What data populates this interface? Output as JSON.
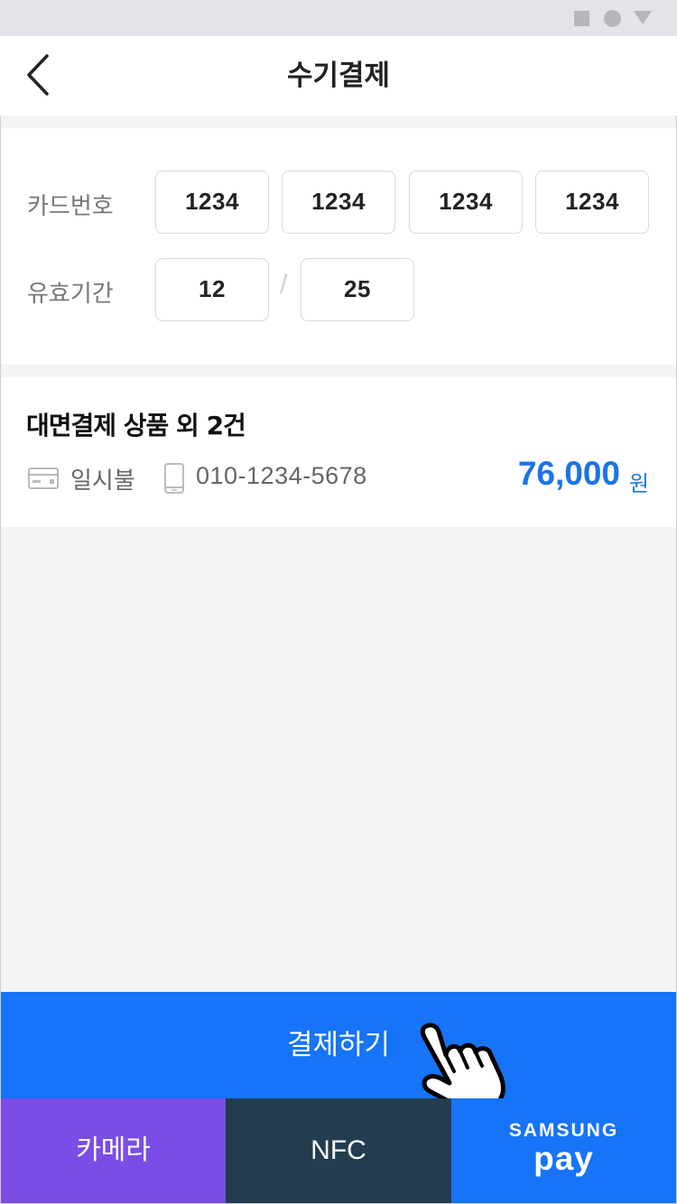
{
  "header": {
    "title": "수기결제",
    "back_icon": "chevron-left-icon"
  },
  "card": {
    "number_label": "카드번호",
    "number_groups": [
      "1234",
      "1234",
      "1234",
      "1234"
    ],
    "expiry_label": "유효기간",
    "expiry_month": "12",
    "expiry_separator": "/",
    "expiry_year": "25"
  },
  "order": {
    "title": "대면결제 상품 외 2건",
    "installment": "일시불",
    "phone": "010-1234-5678",
    "amount": "76,000",
    "currency": "원"
  },
  "actions": {
    "pay_label": "결제하기",
    "camera_label": "카메라",
    "nfc_label": "NFC",
    "samsung_pay_top": "SAMSUNG",
    "samsung_pay_bottom": "pay"
  },
  "colors": {
    "accent": "#1773f8",
    "camera": "#7a4de6",
    "nfc": "#213d4f",
    "amount": "#1a73e8"
  }
}
